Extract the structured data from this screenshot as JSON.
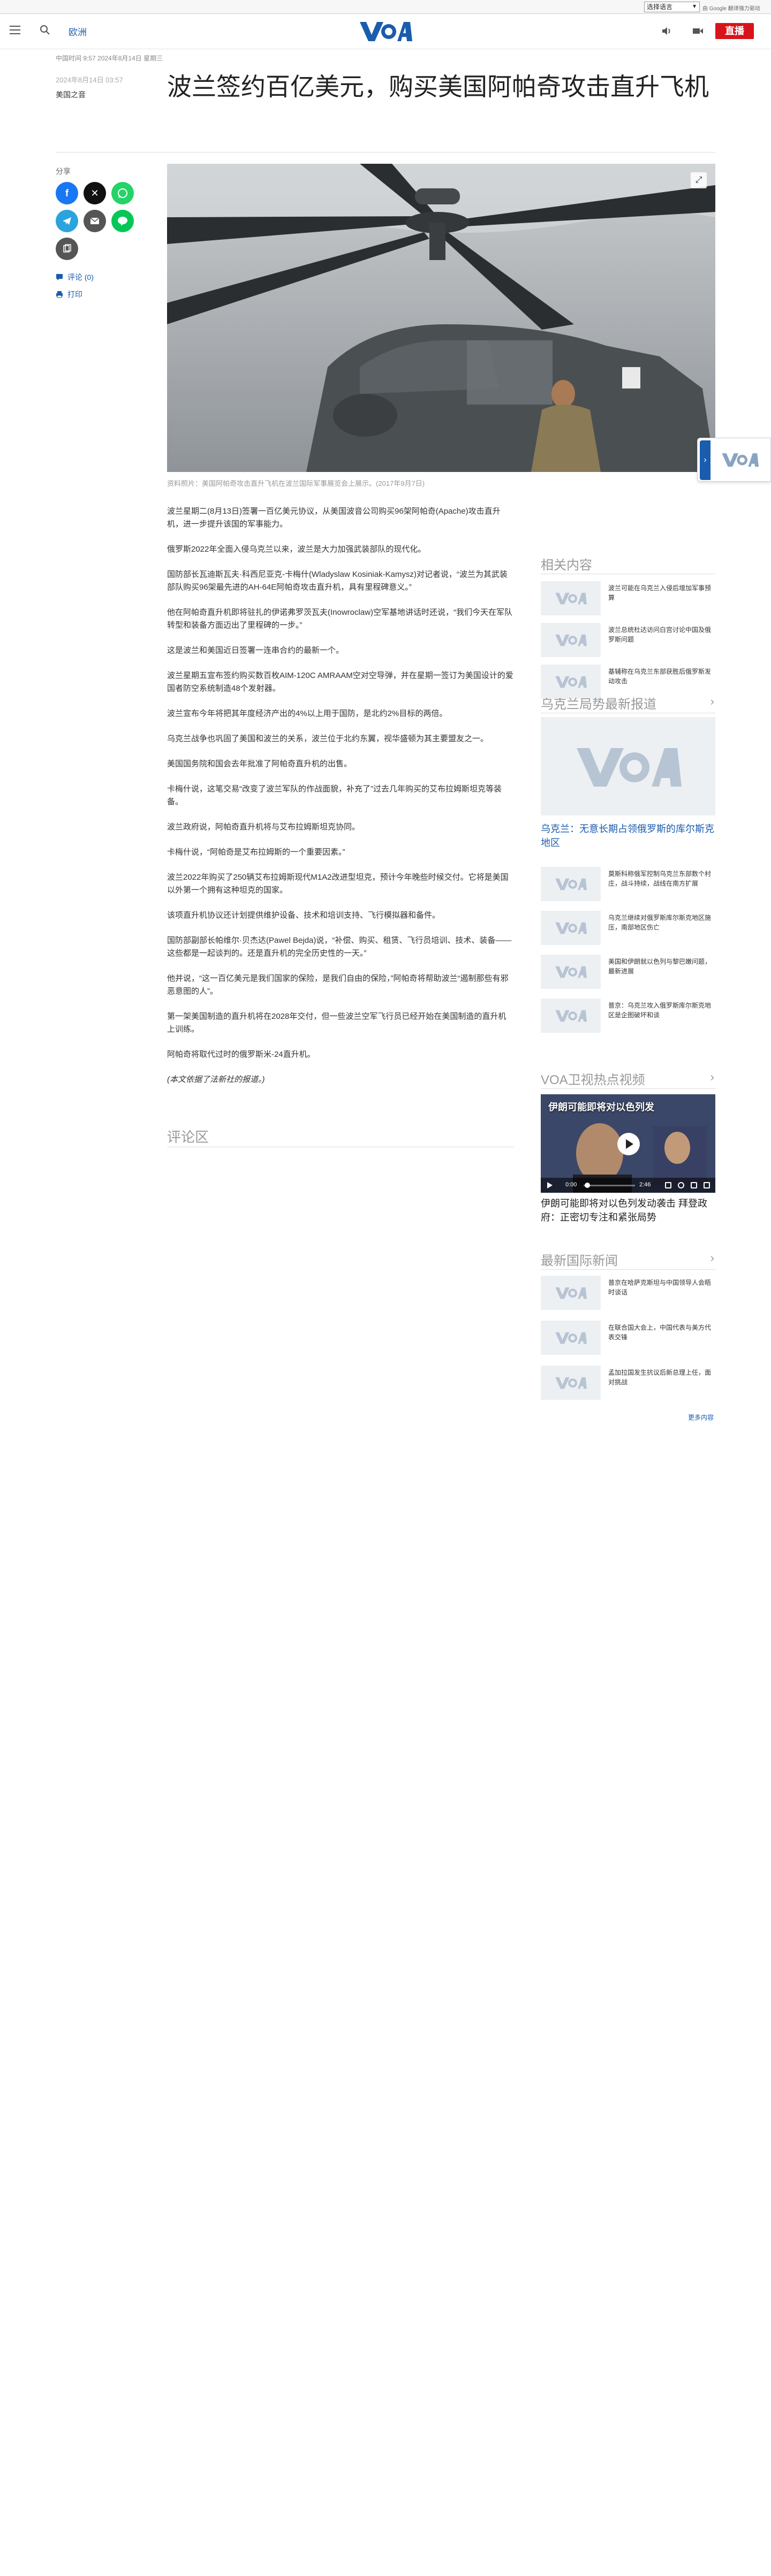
{
  "translate": {
    "select_label": "选择语言",
    "powered": "由 Google 翻译强力驱动"
  },
  "header": {
    "section": "欧洲",
    "logo_text": "VOA",
    "live_label": "直播"
  },
  "article": {
    "dateline_top": "中国时间 9:57 2024年8月14日 星期三",
    "date": "2024年8月14日 03:57",
    "category": "美国之音",
    "title": "波兰签约百亿美元，购买美国阿帕奇攻击直升飞机",
    "caption": "资料照片：美国阿帕奇攻击直升飞机在波兰国际军事展览会上展示。(2017年9月7日)",
    "paragraphs": [
      "波兰星期二(8月13日)签署一百亿美元协议，从美国波音公司购买96架阿帕奇(Apache)攻击直升机，进一步提升该国的军事能力。",
      "俄罗斯2022年全面入侵乌克兰以来，波兰是大力加强武装部队的现代化。",
      "国防部长瓦迪斯瓦夫·科西尼亚克-卡梅什(Wladyslaw Kosiniak-Kamysz)对记者说，“波兰为其武装部队购买96架最先进的AH-64E阿帕奇攻击直升机，具有里程碑意义。”",
      "他在阿帕奇直升机即将驻扎的伊诺弗罗茨瓦夫(Inowroclaw)空军基地讲话时还说，“我们今天在军队转型和装备方面迈出了里程碑的一步。”",
      "这是波兰和美国近日签署一连串合约的最新一个。",
      "波兰星期五宣布签约购买数百枚AIM-120C AMRAAM空对空导弹，并在星期一签订为美国设计的爱国者防空系统制造48个发射器。",
      "波兰宣布今年将把其年度经济产出的4%以上用于国防，是北约2%目标的两倍。",
      "乌克兰战争也巩固了美国和波兰的关系，波兰位于北约东翼，视华盛顿为其主要盟友之一。",
      "美国国务院和国会去年批准了阿帕奇直升机的出售。",
      "卡梅什说，这笔交易“改变了波兰军队的作战面貌，补充了”过去几年购买的艾布拉姆斯坦克等装备。",
      "波兰政府说，阿帕奇直升机将与艾布拉姆斯坦克协同。",
      "卡梅什说，“阿帕奇是艾布拉姆斯的一个重要因素。”",
      "波兰2022年购买了250辆艾布拉姆斯现代M1A2改进型坦克，预计今年晚些时候交付。它将是美国以外第一个拥有这种坦克的国家。",
      "该项直升机协议还计划提供维护设备、技术和培训支持、飞行模拟器和备件。",
      "国防部副部长帕维尔·贝杰达(Pawel Bejda)说，“补偿、购买、租赁、飞行员培训、技术、装备——这些都是一起谈判的。还是直升机的完全历史性的一天。”",
      "他并说，“这一百亿美元是我们国家的保险，是我们自由的保险，”阿帕奇将帮助波兰“遏制那些有邪恶意图的人”。",
      "第一架美国制造的直升机将在2028年交付，但一些波兰空军飞行员已经开始在美国制造的直升机上训练。",
      "阿帕奇将取代过时的俄罗斯米-24直升机。",
      "(本文依据了法新社的报道。)"
    ],
    "comments_title": "评论区"
  },
  "share": {
    "label": "分享",
    "comments_link": "评论 (0)",
    "print_link": "打印"
  },
  "sidebar": {
    "related_title": "相关内容",
    "related": [
      "波兰可能在乌克兰入侵后增加军事预算",
      "波兰总统杜达访问白宫讨论中国及俄罗斯问题",
      "基辅称在乌克兰东部获胜后俄罗斯发动攻击"
    ],
    "ukraine_title": "乌克兰局势最新报道",
    "ukraine_feature": "乌克兰：无意长期占领俄罗斯的库尔斯克地区",
    "ukraine": [
      "莫斯科称俄军控制乌克兰东部数个村庄，战斗持续，战线在南方扩展",
      "乌克兰继续对俄罗斯库尔斯克地区施压，南部地区伤亡",
      "美国和伊朗就以色列与黎巴嫩问题，最新进展",
      "普京：乌克兰攻入俄罗斯库尔斯克地区是企图破坏和谈"
    ],
    "video_title": "VOA卫视热点视频",
    "video_overlay": "伊朗可能即将对以色列发",
    "video_time": "0:00",
    "video_duration": "2:46",
    "video_caption": "伊朗可能即将对以色列发动袭击 拜登政府：正密切专注和紧张局势",
    "intl_title": "最新国际新闻",
    "intl": [
      "普京在哈萨克斯坦与中国领导人会晤时谈话",
      "在联合国大会上，中国代表与美方代表交锋",
      "孟加拉国发生抗议后新总理上任，面对挑战"
    ],
    "more": "更多内容"
  }
}
